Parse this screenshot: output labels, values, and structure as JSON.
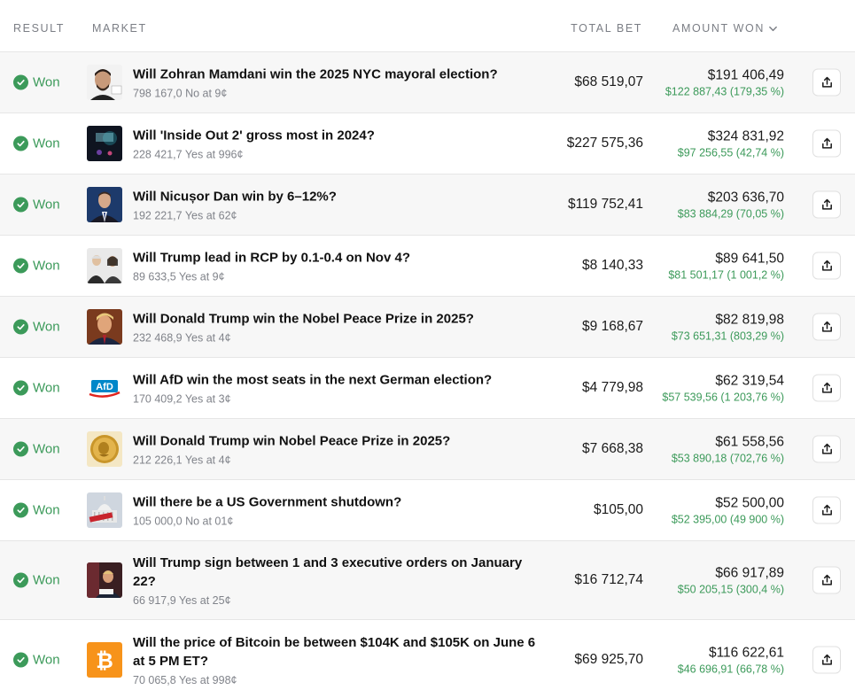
{
  "columns": {
    "result": "RESULT",
    "market": "MARKET",
    "total_bet": "TOTAL BET",
    "amount_won": "AMOUNT WON"
  },
  "colors": {
    "accent_green": "#3c9a5a",
    "row_alt": "#f7f7f7",
    "text_muted": "#80838a"
  },
  "rows": [
    {
      "result": "Won",
      "title": "Will Zohran Mamdani win the 2025 NYC mayoral election?",
      "shares": "798 167,0 No at 9¢",
      "total_bet": "$68 519,07",
      "amount_won": "$191 406,49",
      "gain": "$122 887,43 (179,35 %)",
      "thumb": "portrait-smiling-man",
      "h": 69
    },
    {
      "result": "Won",
      "title": "Will 'Inside Out 2' gross most in 2024?",
      "shares": "228 421,7 Yes at 996¢",
      "total_bet": "$227 575,36",
      "amount_won": "$324 831,92",
      "gain": "$97 256,55 (42,74 %)",
      "thumb": "movie-poster",
      "h": 69
    },
    {
      "result": "Won",
      "title": "Will Nicușor Dan win by 6–12%?",
      "shares": "192 221,7 Yes at 62¢",
      "total_bet": "$119 752,41",
      "amount_won": "$203 636,70",
      "gain": "$83 884,29 (70,05 %)",
      "thumb": "portrait-man-suit",
      "h": 69
    },
    {
      "result": "Won",
      "title": "Will Trump lead in RCP by 0.1-0.4 on Nov 4?",
      "shares": "89 633,5 Yes at 9¢",
      "total_bet": "$8 140,33",
      "amount_won": "$89 641,50",
      "gain": "$81 501,17 (1 001,2 %)",
      "thumb": "candidates-photo",
      "h": 69
    },
    {
      "result": "Won",
      "title": "Will Donald Trump win the Nobel Peace Prize in 2025?",
      "shares": "232 468,9 Yes at 4¢",
      "total_bet": "$9 168,67",
      "amount_won": "$82 819,98",
      "gain": "$73 651,31 (803,29 %)",
      "thumb": "portrait-trump",
      "h": 69
    },
    {
      "result": "Won",
      "title": "Will AfD win the most seats in the next German election?",
      "shares": "170 409,2 Yes at 3¢",
      "total_bet": "$4 779,98",
      "amount_won": "$62 319,54",
      "gain": "$57 539,56 (1 203,76 %)",
      "thumb": "afd-logo",
      "thumb_text": "AfD",
      "h": 69
    },
    {
      "result": "Won",
      "title": "Will Donald Trump win Nobel Peace Prize in 2025?",
      "shares": "212 226,1 Yes at 4¢",
      "total_bet": "$7 668,38",
      "amount_won": "$61 558,56",
      "gain": "$53 890,18 (702,76 %)",
      "thumb": "nobel-medal",
      "h": 69
    },
    {
      "result": "Won",
      "title": "Will there be a US Government shutdown?",
      "shares": "105 000,0 No at 01¢",
      "total_bet": "$105,00",
      "amount_won": "$52 500,00",
      "gain": "$52 395,00 (49 900 %)",
      "thumb": "capitol-closed",
      "h": 69
    },
    {
      "result": "Won",
      "title": "Will Trump sign between 1 and 3 executive orders on January 22?",
      "shares": "66 917,9 Yes at 25¢",
      "total_bet": "$16 712,74",
      "amount_won": "$66 917,89",
      "gain": "$50 205,15 (300,4 %)",
      "thumb": "signing-orders",
      "h": 89
    },
    {
      "result": "Won",
      "title": "Will the price of Bitcoin be between $104K and $105K on June 6 at 5 PM ET?",
      "shares": "70 065,8 Yes at 998¢",
      "total_bet": "$69 925,70",
      "amount_won": "$116 622,61",
      "gain": "$46 696,91 (66,78 %)",
      "thumb": "bitcoin-icon",
      "h": 90
    }
  ]
}
